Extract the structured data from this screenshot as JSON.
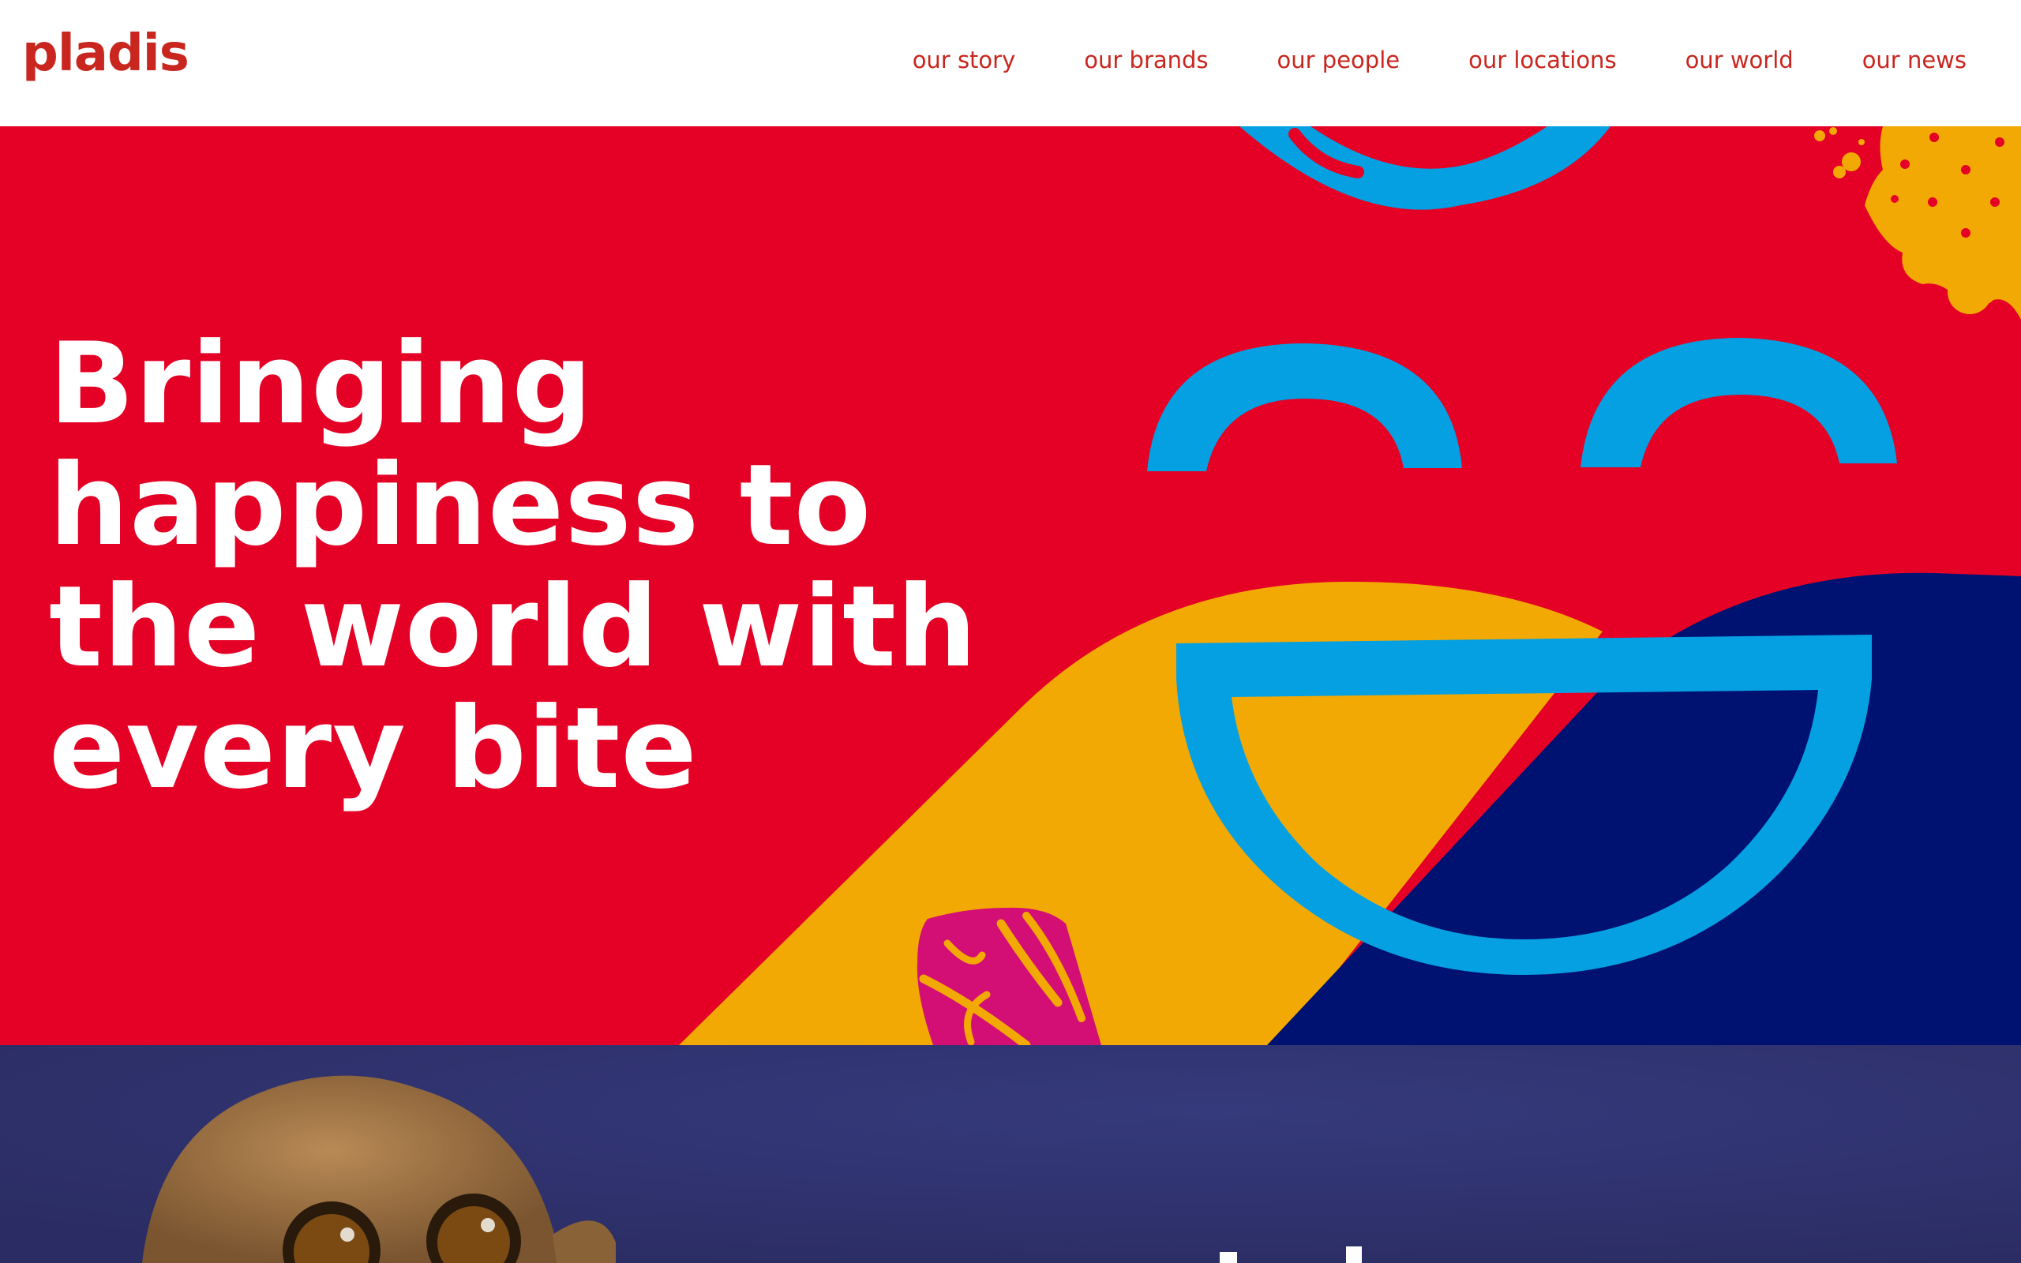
{
  "header": {
    "logo_text": "pladis",
    "nav": [
      {
        "label": "our story"
      },
      {
        "label": "our brands"
      },
      {
        "label": "our people"
      },
      {
        "label": "our locations"
      },
      {
        "label": "our world"
      },
      {
        "label": "our news"
      }
    ]
  },
  "hero": {
    "headline": "Bringing happiness to the world with every bite"
  },
  "colors": {
    "brand_red": "#e40125",
    "nav_red": "#c8261e",
    "sky_blue": "#04a0e2",
    "yellow": "#f3a904",
    "navy": "#001271",
    "pink": "#d30e74",
    "section_purple": "#2e2f6b"
  }
}
